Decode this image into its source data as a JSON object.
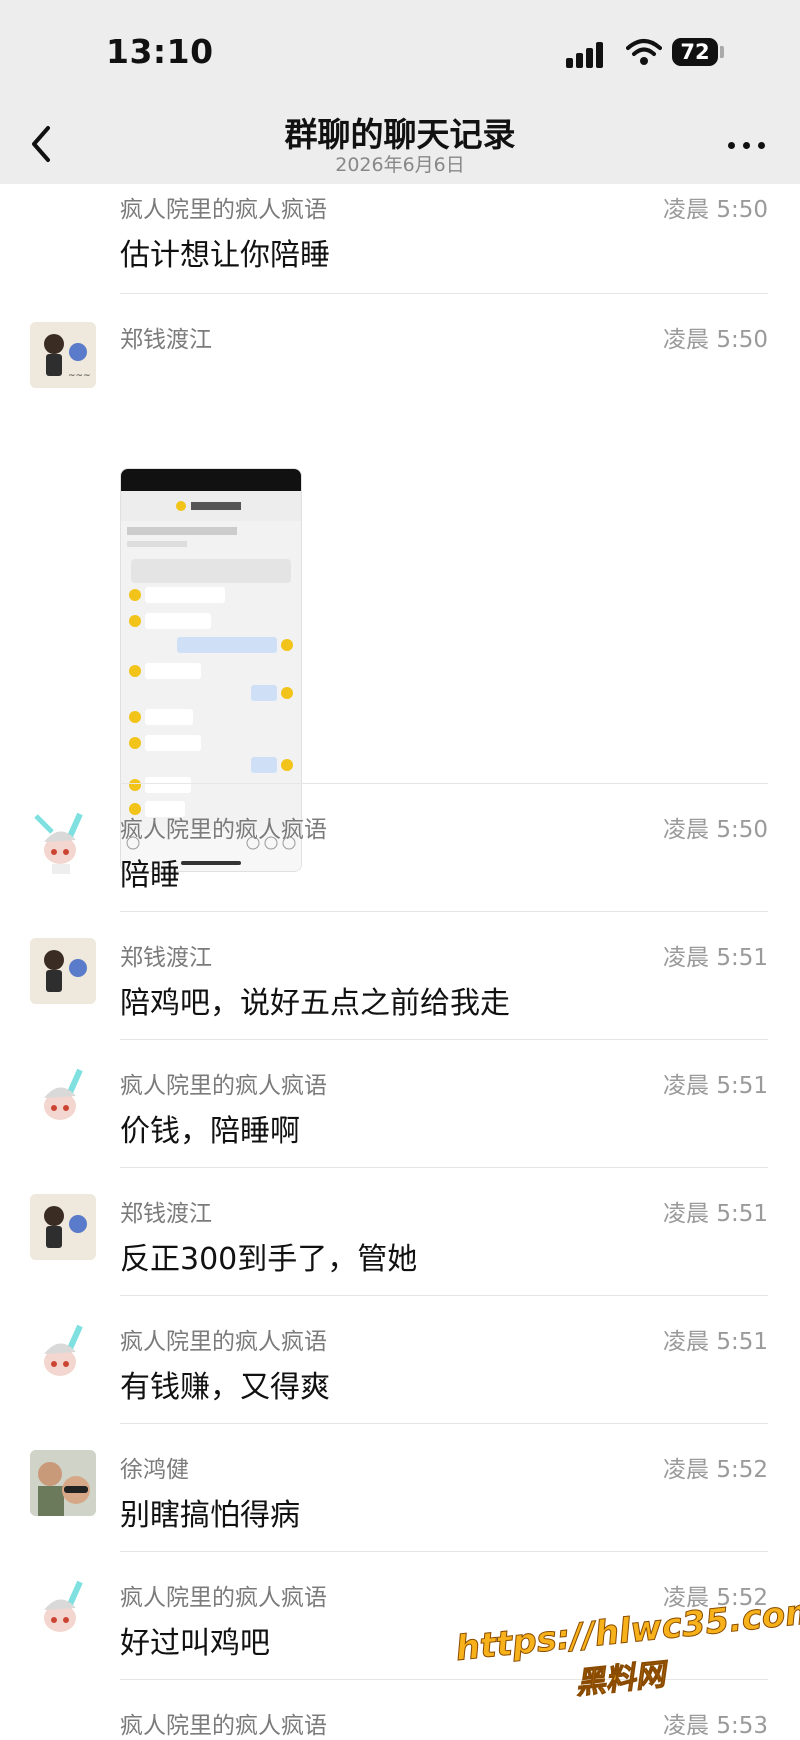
{
  "status": {
    "time": "13:10",
    "battery": "72"
  },
  "nav": {
    "title": "群聊的聊天记录",
    "subtitle": "2026年6月6日"
  },
  "messages": [
    {
      "sender": "疯人院里的疯人疯语",
      "time": "凌晨 5:50",
      "text": "估计想让你陪睡"
    },
    {
      "sender": "郑钱渡江",
      "time": "凌晨 5:50",
      "text": "",
      "image": "chat-screenshot"
    },
    {
      "sender": "疯人院里的疯人疯语",
      "time": "凌晨 5:50",
      "text": "陪睡"
    },
    {
      "sender": "郑钱渡江",
      "time": "凌晨 5:51",
      "text": "陪鸡吧，说好五点之前给我走"
    },
    {
      "sender": "疯人院里的疯人疯语",
      "time": "凌晨 5:51",
      "text": "价钱，陪睡啊"
    },
    {
      "sender": "郑钱渡江",
      "time": "凌晨 5:51",
      "text": "反正300到手了，管她"
    },
    {
      "sender": "疯人院里的疯人疯语",
      "time": "凌晨 5:51",
      "text": "有钱赚，又得爽"
    },
    {
      "sender": "徐鸿健",
      "time": "凌晨 5:52",
      "text": "别瞎搞怕得病"
    },
    {
      "sender": "疯人院里的疯人疯语",
      "time": "凌晨 5:52",
      "text": "好过叫鸡吧"
    },
    {
      "sender": "疯人院里的疯人疯语",
      "time": "凌晨 5:53",
      "text": ""
    }
  ],
  "watermark": {
    "line1": "https://hlwc35.com",
    "line2": "黑料网"
  },
  "colors": {
    "bar_bg": "#ededed",
    "meta_text": "#9a9a9a",
    "watermark": "#f7b21b"
  }
}
